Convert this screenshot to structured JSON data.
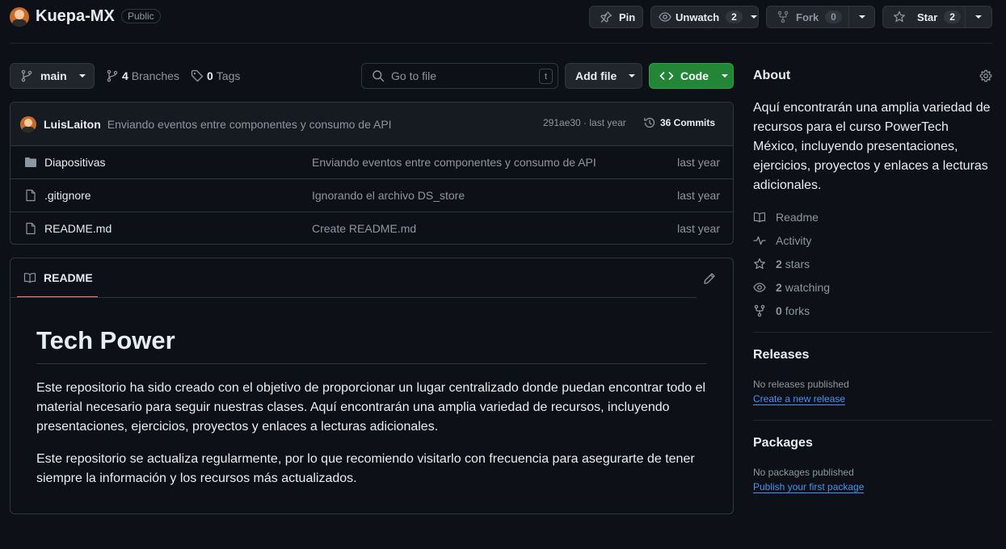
{
  "repo": {
    "name": "Kuepa-MX",
    "visibility": "Public"
  },
  "header_actions": {
    "pin_label": "Pin",
    "unwatch_label": "Unwatch",
    "watch_count": "2",
    "fork_label": "Fork",
    "fork_count": "0",
    "star_label": "Star",
    "star_count": "2"
  },
  "toolbar": {
    "branch": "main",
    "branches_count": "4",
    "branches_label": "Branches",
    "tags_count": "0",
    "tags_label": "Tags",
    "search_placeholder": "Go to file",
    "search_shortcut": "t",
    "add_file_label": "Add file",
    "code_label": "Code"
  },
  "commit": {
    "author": "LuisLaiton",
    "message": "Enviando eventos entre componentes y consumo de API",
    "meta": "291ae30 · last year",
    "commits_label": "36 Commits"
  },
  "files": [
    {
      "type": "folder",
      "name": "Diapositivas",
      "message": "Enviando eventos entre componentes y consumo de API",
      "time": "last year"
    },
    {
      "type": "file",
      "name": ".gitignore",
      "message": "Ignorando el archivo DS_store",
      "time": "last year"
    },
    {
      "type": "file",
      "name": "README.md",
      "message": "Create README.md",
      "time": "last year"
    }
  ],
  "readme": {
    "tab_label": "README",
    "heading": "Tech Power",
    "p1": "Este repositorio ha sido creado con el objetivo de proporcionar un lugar centralizado donde puedan encontrar todo el material necesario para seguir nuestras clases. Aquí encontrarán una amplia variedad de recursos, incluyendo presentaciones, ejercicios, proyectos y enlaces a lecturas adicionales.",
    "p2": "Este repositorio se actualiza regularmente, por lo que recomiendo visitarlo con frecuencia para asegurarte de tener siempre la información y los recursos más actualizados."
  },
  "about": {
    "title": "About",
    "description": "Aquí encontrarán una amplia variedad de recursos para el curso PowerTech México, incluyendo presentaciones, ejercicios, proyectos y enlaces a lecturas adicionales.",
    "readme_label": "Readme",
    "activity_label": "Activity",
    "stars_count": "2",
    "stars_label": "stars",
    "watching_count": "2",
    "watching_label": "watching",
    "forks_count": "0",
    "forks_label": "forks"
  },
  "releases": {
    "title": "Releases",
    "empty": "No releases published",
    "link": "Create a new release"
  },
  "packages": {
    "title": "Packages",
    "empty": "No packages published",
    "link": "Publish your first package"
  },
  "colors": {
    "accent_green": "#238636",
    "link_blue": "#4493f8",
    "tab_underline": "#f78166"
  }
}
